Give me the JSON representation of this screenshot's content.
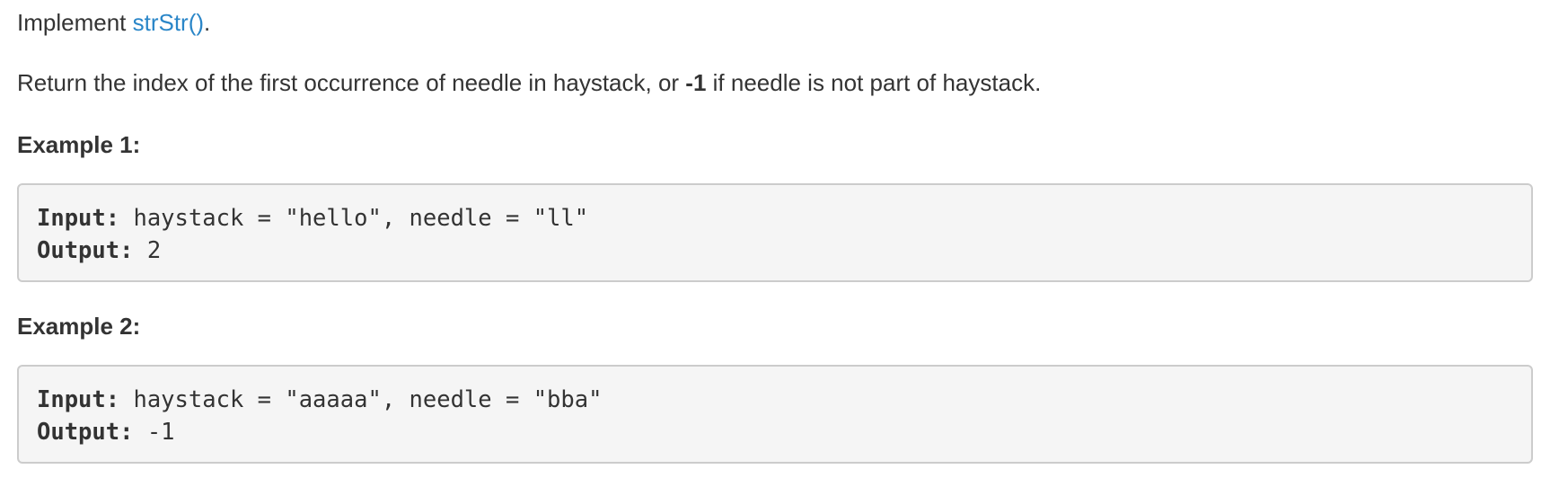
{
  "intro": {
    "prefix": "Implement ",
    "link": "strStr()",
    "suffix": "."
  },
  "description": {
    "before": "Return the index of the first occurrence of needle in haystack, or ",
    "bold": "-1",
    "after": " if needle is not part of haystack."
  },
  "examples": [
    {
      "heading": "Example 1:",
      "input_label": "Input:",
      "input_value": " haystack = \"hello\", needle = \"ll\"",
      "output_label": "Output:",
      "output_value": " 2"
    },
    {
      "heading": "Example 2:",
      "input_label": "Input:",
      "input_value": " haystack = \"aaaaa\", needle = \"bba\"",
      "output_label": "Output:",
      "output_value": " -1"
    }
  ],
  "colors": {
    "link": "#2a86c8",
    "text": "#333333",
    "code_background": "#f5f5f5",
    "code_border": "#cccccc"
  }
}
